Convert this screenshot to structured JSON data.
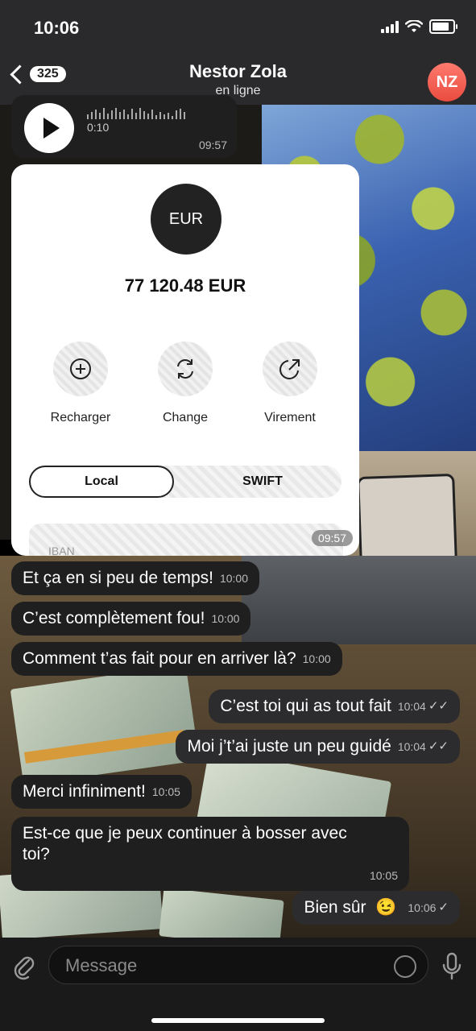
{
  "status_bar": {
    "time": "10:06"
  },
  "header": {
    "back_count": "325",
    "name": "Nestor Zola",
    "status": "en ligne",
    "avatar_initials": "NZ",
    "avatar_color": "#f15a4f"
  },
  "voice_message": {
    "duration": "0:10",
    "time": "09:57"
  },
  "wallet_card": {
    "currency_badge": "EUR",
    "balance": "77 120.48 EUR",
    "actions": [
      {
        "label": "Recharger",
        "icon": "plus-circle-icon"
      },
      {
        "label": "Change",
        "icon": "refresh-icon"
      },
      {
        "label": "Virement",
        "icon": "send-arrow-icon"
      }
    ],
    "segment_left": "Local",
    "segment_right": "SWIFT",
    "iban_label": "IBAN",
    "time": "09:57"
  },
  "messages": [
    {
      "text": "Et ça en si peu de temps!",
      "time": "10:00",
      "dir": "in"
    },
    {
      "text": "C’est complètement fou!",
      "time": "10:00",
      "dir": "in"
    },
    {
      "text": "Comment t’as fait pour en arriver là?",
      "time": "10:00",
      "dir": "in"
    },
    {
      "text": "C’est toi qui as tout fait",
      "time": "10:04",
      "dir": "out",
      "checks": "✓✓"
    },
    {
      "text": "Moi j’t’ai juste un peu guidé",
      "time": "10:04",
      "dir": "out",
      "checks": "✓✓"
    },
    {
      "text": "Merci infiniment!",
      "time": "10:05",
      "dir": "in"
    },
    {
      "text": "Est-ce que je peux continuer à bosser avec",
      "text2": "toi?",
      "time": "10:05",
      "dir": "in"
    },
    {
      "text": "Bien sûr",
      "emoji": "😉",
      "time": "10:06",
      "dir": "out",
      "checks": "✓"
    }
  ],
  "input": {
    "placeholder": "Message"
  }
}
